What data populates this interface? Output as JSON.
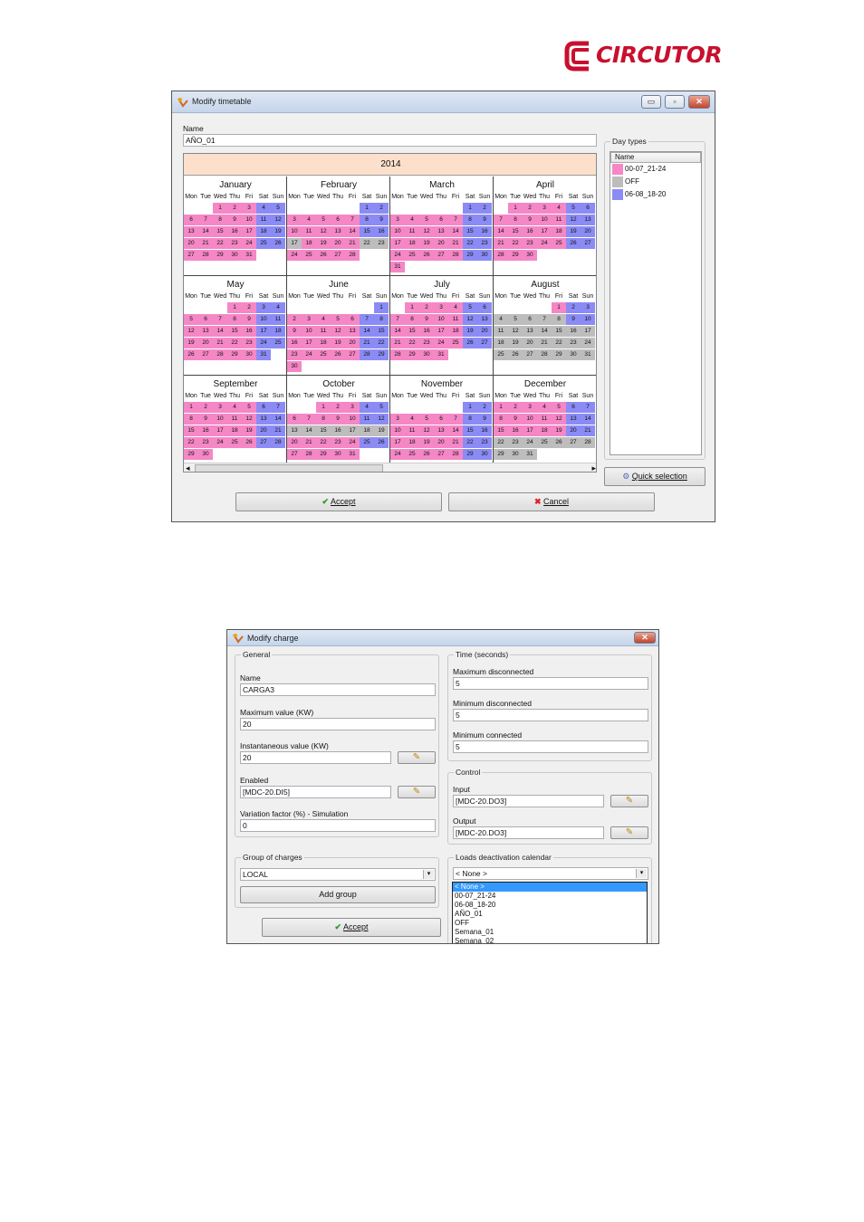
{
  "brand": {
    "name": "CIRCUTOR",
    "color": "#c8102e"
  },
  "colors": {
    "pink": "#f587c6",
    "gray": "#bdbdbd",
    "blue": "#8b8bf5",
    "header": "#fde0cb"
  },
  "timetable_window": {
    "title": "Modify timetable",
    "name_label": "Name",
    "name_value": "AÑO_01",
    "year": "2014",
    "day_headers": [
      "Mon",
      "Tue",
      "Wed",
      "Thu",
      "Fri",
      "Sat",
      "Sun"
    ],
    "months": [
      {
        "name": "January",
        "start": 2,
        "days": 31
      },
      {
        "name": "February",
        "start": 5,
        "days": 28
      },
      {
        "name": "March",
        "start": 5,
        "days": 31
      },
      {
        "name": "April",
        "start": 1,
        "days": 30
      },
      {
        "name": "May",
        "start": 3,
        "days": 31
      },
      {
        "name": "June",
        "start": 6,
        "days": 30
      },
      {
        "name": "July",
        "start": 1,
        "days": 31
      },
      {
        "name": "August",
        "start": 4,
        "days": 31
      },
      {
        "name": "September",
        "start": 0,
        "days": 30
      },
      {
        "name": "October",
        "start": 2,
        "days": 31
      },
      {
        "name": "November",
        "start": 5,
        "days": 30
      },
      {
        "name": "December",
        "start": 0,
        "days": 31
      }
    ],
    "gray_days": {
      "February": [
        17,
        22,
        23
      ],
      "August": [
        4,
        5,
        6,
        7,
        8,
        11,
        12,
        13,
        14,
        15,
        16,
        17,
        18,
        19,
        20,
        21,
        22,
        23,
        24,
        25,
        26,
        27,
        28,
        29,
        30,
        31
      ],
      "October": [
        13,
        14,
        15,
        16,
        17,
        18,
        19
      ],
      "December": [
        22,
        23,
        24,
        25,
        26,
        27,
        28,
        29,
        30,
        31
      ]
    },
    "day_types_label": "Day types",
    "day_types_header": "Name",
    "day_types": [
      {
        "name": "00-07_21-24",
        "color": "#f587c6"
      },
      {
        "name": "OFF",
        "color": "#bdbdbd"
      },
      {
        "name": "06-08_18-20",
        "color": "#8b8bf5"
      }
    ],
    "quick_selection": "Quick selection",
    "accept": "Accept",
    "cancel": "Cancel",
    "btn_min": "▭",
    "btn_max": "▫",
    "btn_close": "✕",
    "scroll_left": "◂",
    "scroll_right": "▸"
  },
  "charge_window": {
    "title": "Modify charge",
    "general_label": "General",
    "name_label": "Name",
    "name_value": "CARGA3",
    "max_value_label": "Maximum value (KW)",
    "max_value": "20",
    "inst_value_label": "Instantaneous value (KW)",
    "inst_value": "20",
    "enabled_label": "Enabled",
    "enabled_value": "[MDC-20.DI5]",
    "variation_label": "Variation factor (%) - Simulation",
    "variation_value": "0",
    "time_label": "Time (seconds)",
    "max_disc_label": "Maximum disconnected",
    "max_disc": "5",
    "min_disc_label": "Minimum disconnected",
    "min_disc": "5",
    "min_conn_label": "Minimum connected",
    "min_conn": "5",
    "control_label": "Control",
    "input_label": "Input",
    "input_value": "[MDC-20.DO3]",
    "output_label": "Output",
    "output_value": "[MDC-20.DO3]",
    "group_label": "Group of charges",
    "group_value": "LOCAL",
    "add_group": "Add group",
    "calendar_label": "Loads deactivation calendar",
    "calendar_value": "< None >",
    "calendar_options": [
      "< None >",
      "00-07_21-24",
      "06-08_18-20",
      "AÑO_01",
      "OFF",
      "Semana_01",
      "Semana_02"
    ],
    "accept": "Accept",
    "btn_close": "✕",
    "dd_arrow": "▾",
    "pick_icon": "✎"
  },
  "icons": {
    "accept": "check-icon",
    "cancel": "x-icon",
    "quick": "gear-icon"
  }
}
